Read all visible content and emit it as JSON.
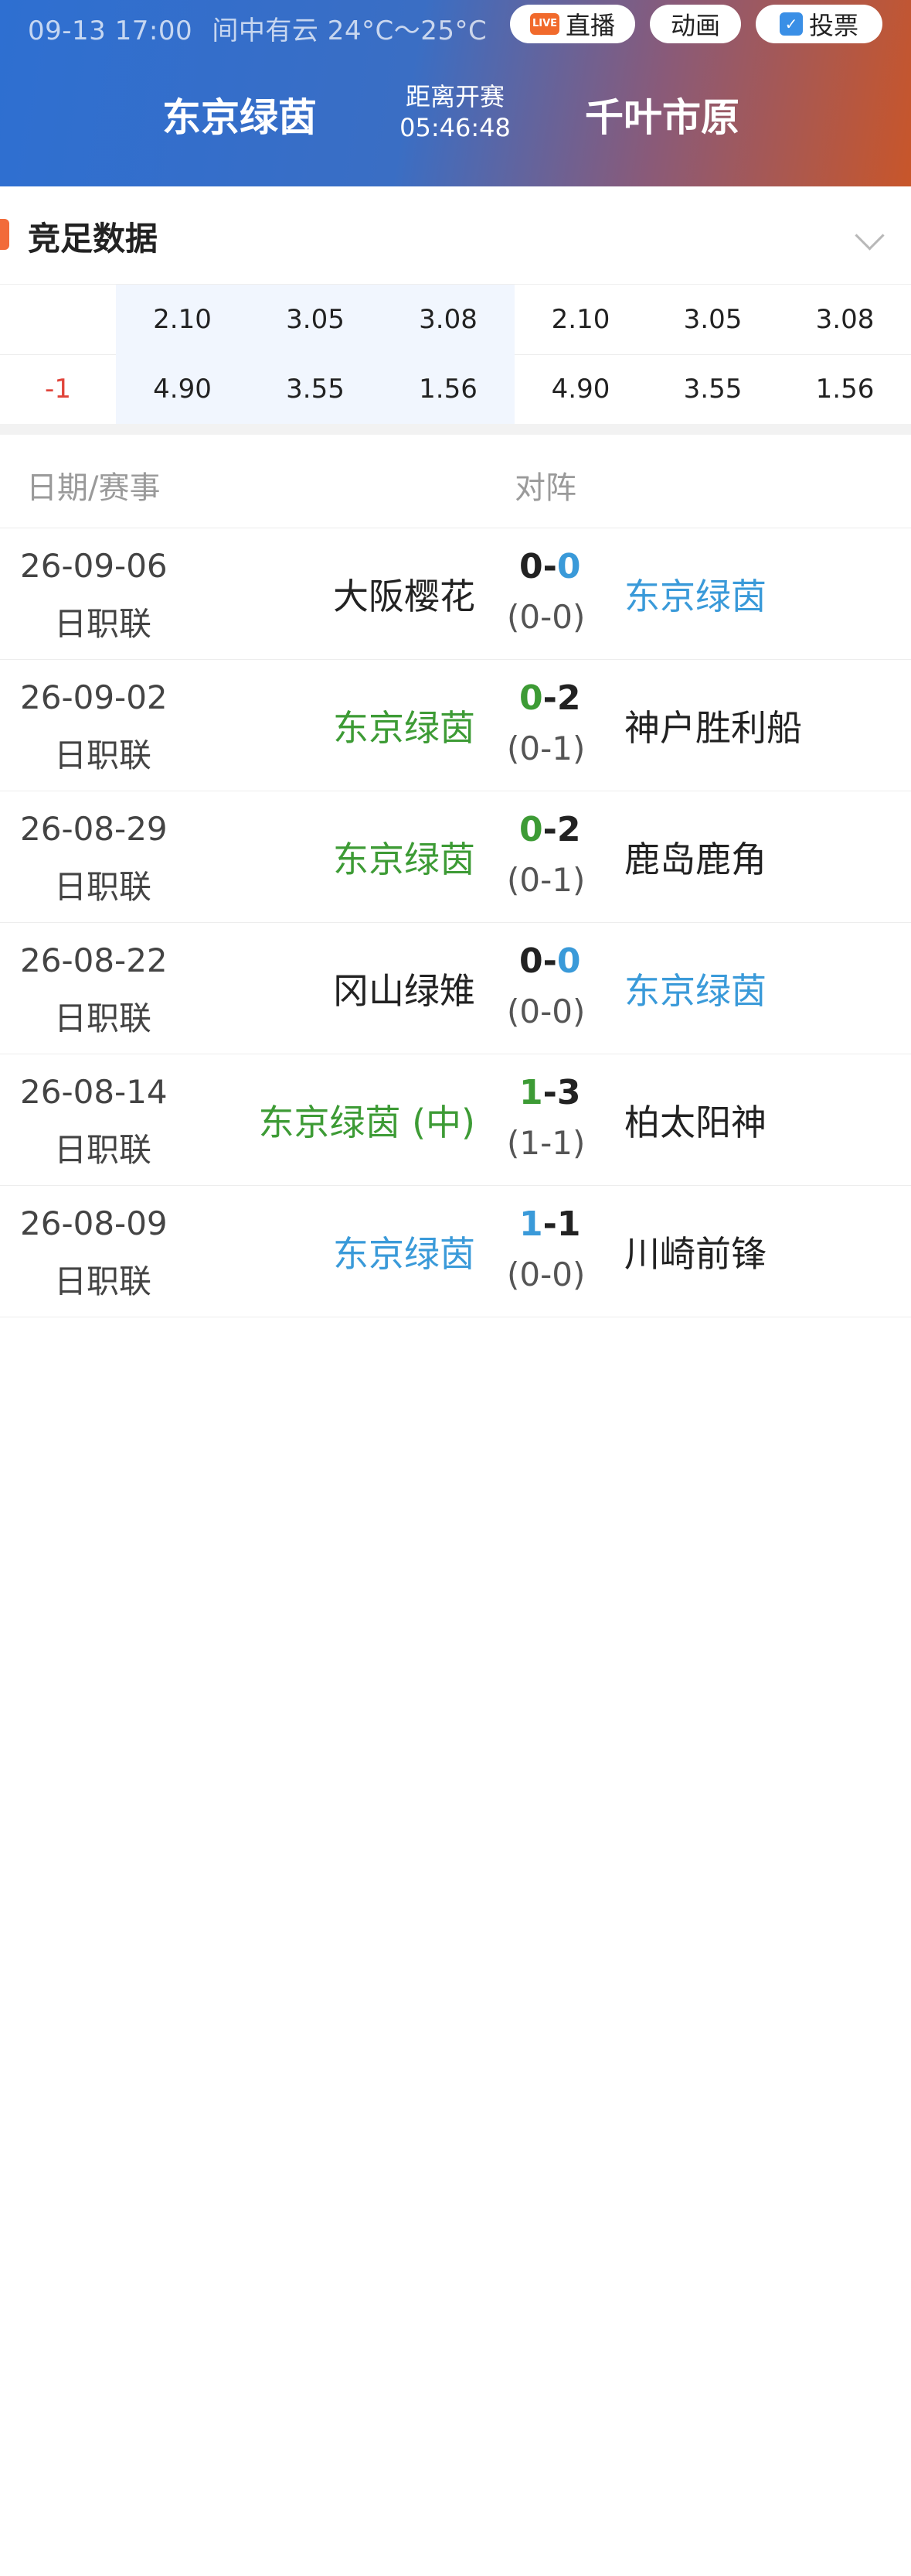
{
  "header": {
    "date_time": "09-13 17:00",
    "weather": "间中有云 24°C～25°C",
    "live_badge": "LIVE",
    "live_label": "直播",
    "animation_label": "动画",
    "vote_label": "投票",
    "home_team": "东京绿茵",
    "away_team": "千叶市原",
    "countdown_label": "距离开赛",
    "countdown_time": "05:46:48"
  },
  "odds": {
    "title": "竞足数据",
    "row1": {
      "label": "",
      "values": [
        "2.10",
        "3.05",
        "3.08",
        "2.10",
        "3.05",
        "3.08"
      ]
    },
    "row2": {
      "label": "-1",
      "values": [
        "4.90",
        "3.55",
        "1.56",
        "4.90",
        "3.55",
        "1.56"
      ]
    }
  },
  "history": {
    "date_header": "日期/赛事",
    "match_header": "对阵",
    "matches": [
      {
        "date": "26-09-06",
        "league": "日职联",
        "home": "大阪樱花",
        "score_home": "0",
        "score_away": "0",
        "half": "(0-0)",
        "away": "东京绿茵"
      },
      {
        "date": "26-09-02",
        "league": "日职联",
        "home": "东京绿茵",
        "score_home": "0",
        "score_away": "2",
        "half": "(0-1)",
        "away": "神户胜利船"
      },
      {
        "date": "26-08-29",
        "league": "日职联",
        "home": "东京绿茵",
        "score_home": "0",
        "score_away": "2",
        "half": "(0-1)",
        "away": "鹿岛鹿角"
      },
      {
        "date": "26-08-22",
        "league": "日职联",
        "home": "冈山绿雉",
        "score_home": "0",
        "score_away": "0",
        "half": "(0-0)",
        "away": "东京绿茵"
      },
      {
        "date": "26-08-14",
        "league": "日职联",
        "home": "东京绿茵 (中)",
        "score_home": "1",
        "score_away": "3",
        "half": "(1-1)",
        "away": "柏太阳神"
      },
      {
        "date": "26-08-09",
        "league": "日职联",
        "home": "东京绿茵",
        "score_home": "1",
        "score_away": "1",
        "half": "(0-0)",
        "away": "川崎前锋"
      }
    ]
  },
  "colors": {
    "win_green": "#3d9b35",
    "draw_blue": "#3a9ad9",
    "accent": "#f26b3a"
  }
}
